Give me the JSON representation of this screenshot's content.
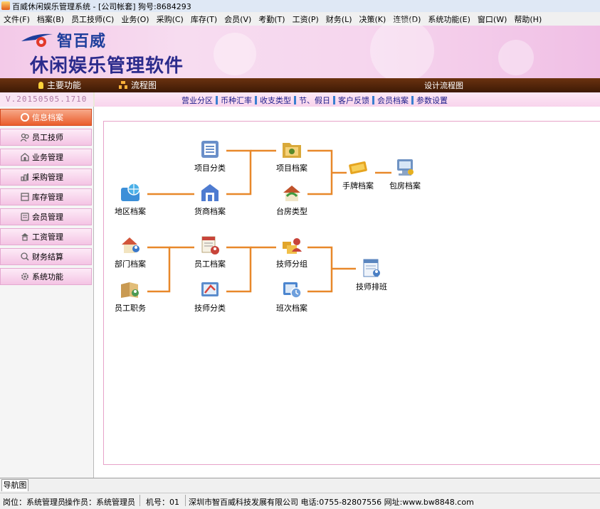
{
  "window": {
    "title": "百威休闲娱乐管理系统 - [公司帐套] 狗号:8684293"
  },
  "menu": [
    "文件(F)",
    "档案(B)",
    "员工技师(C)",
    "业务(O)",
    "采购(C)",
    "库存(T)",
    "会员(V)",
    "考勤(T)",
    "工资(P)",
    "财务(L)",
    "决策(K)",
    "连锁(D)",
    "系统功能(E)",
    "窗口(W)",
    "帮助(H)"
  ],
  "banner": {
    "brand": "智百威",
    "product": "休闲娱乐管理软件"
  },
  "navbar": {
    "main_function": "主要功能",
    "flowchart": "流程图",
    "design_flowchart": "设计流程图"
  },
  "version": "V.20150505.1710",
  "tabs": [
    "营业分区",
    "币种汇率",
    "收支类型",
    "节、假日",
    "客户反馈",
    "会员档案",
    "参数设置"
  ],
  "sidebar": [
    {
      "label": "信息档案",
      "icon": "info-archive-icon",
      "active": true,
      "color": "#c0392b"
    },
    {
      "label": "员工技师",
      "icon": "staff-icon",
      "active": false,
      "color": "#666666"
    },
    {
      "label": "业务管理",
      "icon": "business-icon",
      "active": false,
      "color": "#666666"
    },
    {
      "label": "采购管理",
      "icon": "purchase-icon",
      "active": false,
      "color": "#666666"
    },
    {
      "label": "库存管理",
      "icon": "inventory-icon",
      "active": false,
      "color": "#666666"
    },
    {
      "label": "会员管理",
      "icon": "member-icon",
      "active": false,
      "color": "#666666"
    },
    {
      "label": "工资管理",
      "icon": "salary-icon",
      "active": false,
      "color": "#666666"
    },
    {
      "label": "财务结算",
      "icon": "finance-icon",
      "active": false,
      "color": "#666666"
    },
    {
      "label": "系统功能",
      "icon": "gear-icon",
      "active": false,
      "color": "#666666"
    }
  ],
  "flow": {
    "line_color": "#e8882a",
    "nodes": {
      "project_category": {
        "label": "项目分类",
        "icon": "category-icon",
        "color": "#6a8fc9"
      },
      "supplier": {
        "label": "货商档案",
        "icon": "supplier-icon",
        "color": "#4e7bd0"
      },
      "region": {
        "label": "地区档案",
        "icon": "globe-folder-icon",
        "color": "#3c8fd8"
      },
      "project": {
        "label": "项目档案",
        "icon": "project-folder-icon",
        "color": "#d9a93a"
      },
      "room_type": {
        "label": "台房类型",
        "icon": "room-type-icon",
        "color": "#c0522a"
      },
      "wristband": {
        "label": "手牌档案",
        "icon": "wristband-icon",
        "color": "#e6a520"
      },
      "private_room": {
        "label": "包房档案",
        "icon": "private-room-icon",
        "color": "#6f93c3"
      },
      "department": {
        "label": "部门档案",
        "icon": "department-icon",
        "color": "#d2553a"
      },
      "job_title": {
        "label": "员工职务",
        "icon": "job-book-icon",
        "color": "#c99a52"
      },
      "employee": {
        "label": "员工档案",
        "icon": "employee-icon",
        "color": "#c8443a"
      },
      "technician_category": {
        "label": "技师分类",
        "icon": "technician-category-icon",
        "color": "#5b8ccc"
      },
      "technician_group": {
        "label": "技师分组",
        "icon": "technician-group-icon",
        "color": "#e2a52a"
      },
      "shift": {
        "label": "班次档案",
        "icon": "shift-icon",
        "color": "#4c86cf"
      },
      "technician_schedule": {
        "label": "技师排班",
        "icon": "schedule-icon",
        "color": "#5b86bf"
      }
    }
  },
  "bottom_tab": "导航图",
  "status": {
    "position": "岗位：系统管理员",
    "operator": "操作员：系统管理员",
    "machine": "机号：01",
    "company": "深圳市智百威科技发展有限公司 电话:0755-82807556 网址:www.bw8848.com"
  }
}
